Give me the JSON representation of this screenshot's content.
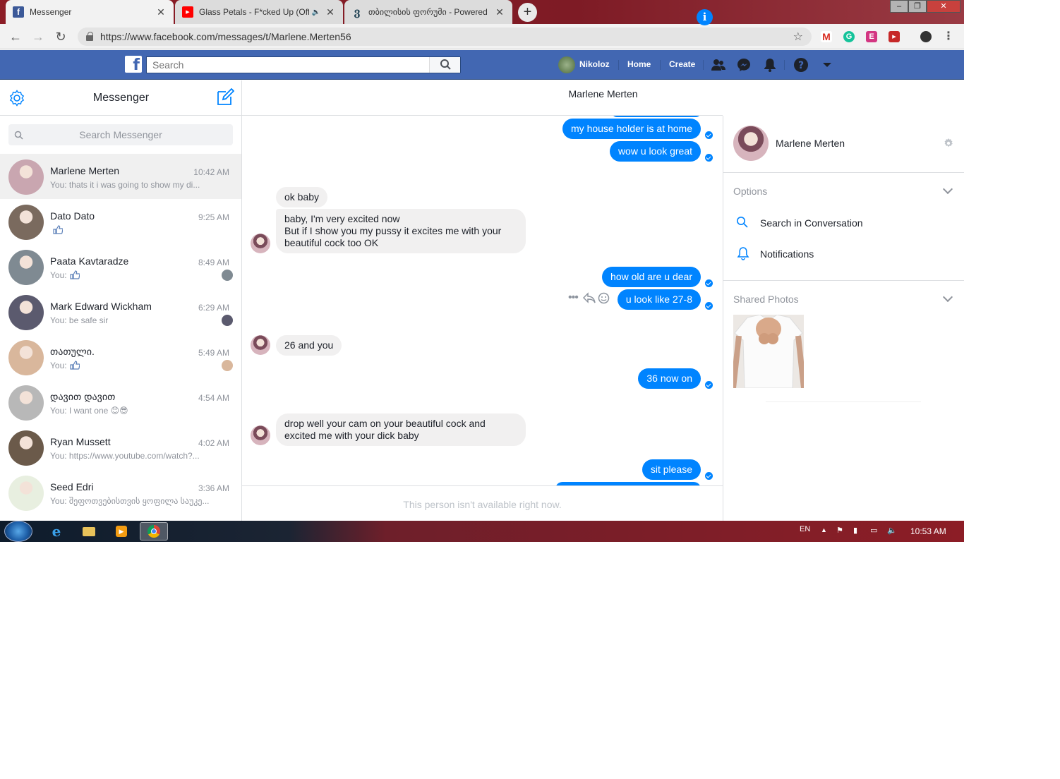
{
  "browser": {
    "tabs": [
      {
        "title": "Messenger",
        "icon": "facebook-icon"
      },
      {
        "title": "Glass Petals - F*cked Up (Off",
        "icon": "youtube-icon"
      },
      {
        "title": "თბილისის ფორუმი - Powered b",
        "icon": "forum-icon"
      }
    ],
    "url": "https://www.facebook.com/messages/t/Marlene.Merten56"
  },
  "fb_header": {
    "search_placeholder": "Search",
    "user_name": "Nikoloz",
    "nav": [
      "Home",
      "Create"
    ]
  },
  "sidebar": {
    "title": "Messenger",
    "search_placeholder": "Search Messenger",
    "threads": [
      {
        "name": "Marlene Merten",
        "time": "10:42 AM",
        "snippet": "You: thats it i was going to show my di...",
        "avatar_color": "#c9a6b0",
        "selected": true
      },
      {
        "name": "Dato Dato",
        "time": "9:25 AM",
        "snippet": "",
        "like": true,
        "avatar_color": "#7a6a5e"
      },
      {
        "name": "Paata Kavtaradze",
        "time": "8:49 AM",
        "snippet": "You:",
        "like": true,
        "avatar_color": "#7f8a92"
      },
      {
        "name": "Mark Edward Wickham",
        "time": "6:29 AM",
        "snippet": "You: be safe sir",
        "avatar_color": "#5b5a6e"
      },
      {
        "name": "თათული.",
        "time": "5:49 AM",
        "snippet": "You:",
        "like": true,
        "avatar_color": "#d9b79c"
      },
      {
        "name": "დავით დავით",
        "time": "4:54 AM",
        "snippet": "You: I want one 😊😎",
        "avatar_color": "#b8b8b8"
      },
      {
        "name": "Ryan Mussett",
        "time": "4:02 AM",
        "snippet": "You: https://www.youtube.com/watch?...",
        "avatar_color": "#6b5a4a"
      },
      {
        "name": "Seed Edri",
        "time": "3:36 AM",
        "snippet": "You: შეფოთვებისთვის ყოფილა საუკე...",
        "avatar_color": "#e8efe0"
      }
    ]
  },
  "conversation": {
    "name": "Marlene Merten",
    "messages": [
      {
        "dir": "out",
        "text": "my house holder is at home"
      },
      {
        "dir": "out",
        "text": "wow u look great"
      },
      {
        "dir": "in",
        "text": "ok baby"
      },
      {
        "dir": "in",
        "lines": [
          "baby, I'm very excited now",
          "But if I show you my pussy it excites me with your",
          "beautiful cock too OK"
        ]
      },
      {
        "dir": "out",
        "text": "how old are u dear"
      },
      {
        "dir": "out",
        "text": "u look like 27-8"
      },
      {
        "dir": "in",
        "text": "26 and you"
      },
      {
        "dir": "out",
        "text": "36 now on"
      },
      {
        "dir": "in",
        "lines": [
          "drop well your cam on your beautiful cock and",
          "excited me with your dick baby"
        ]
      },
      {
        "dir": "out",
        "text": "sit please"
      }
    ],
    "composer_notice": "This person isn't available right now."
  },
  "info_panel": {
    "name": "Marlene Merten",
    "options_label": "Options",
    "options": [
      "Search in Conversation",
      "Notifications"
    ],
    "shared_photos_label": "Shared Photos"
  },
  "taskbar": {
    "language": "EN",
    "clock": "10:53 AM"
  },
  "colors": {
    "fb_blue": "#4267b2",
    "messenger_blue": "#0084ff",
    "bubble_gray": "#f1f0f0"
  }
}
